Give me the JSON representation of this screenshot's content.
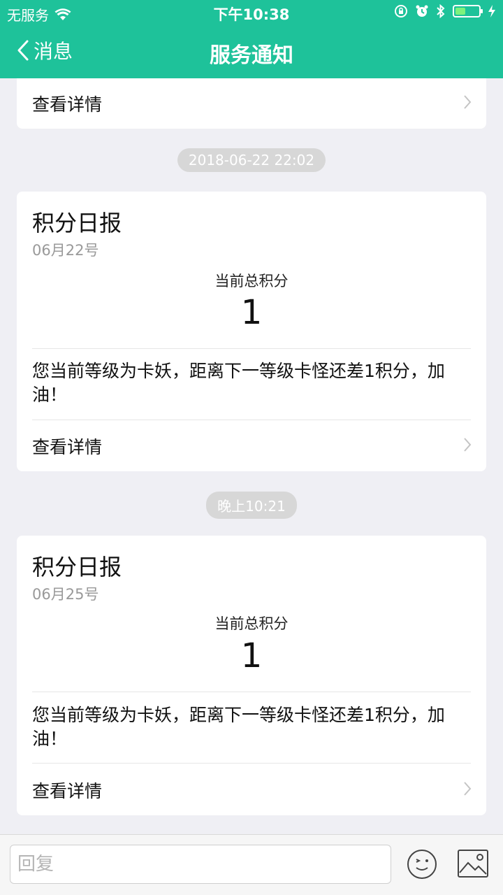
{
  "status": {
    "carrier": "无服务",
    "time": "下午10:38"
  },
  "nav": {
    "back_label": "消息",
    "title": "服务通知"
  },
  "top_card": {
    "detail_label": "查看详情"
  },
  "messages": [
    {
      "timestamp": "2018-06-22 22:02",
      "title": "积分日报",
      "date": "06月22号",
      "points_label": "当前总积分",
      "points_value": "1",
      "text": "您当前等级为卡妖，距离下一等级卡怪还差1积分，加油！",
      "detail_label": "查看详情"
    },
    {
      "timestamp": "晚上10:21",
      "title": "积分日报",
      "date": "06月25号",
      "points_label": "当前总积分",
      "points_value": "1",
      "text": "您当前等级为卡妖，距离下一等级卡怪还差1积分，加油！",
      "detail_label": "查看详情"
    }
  ],
  "reply": {
    "placeholder": "回复"
  },
  "colors": {
    "accent": "#1ec29a",
    "background": "#efeff4"
  }
}
